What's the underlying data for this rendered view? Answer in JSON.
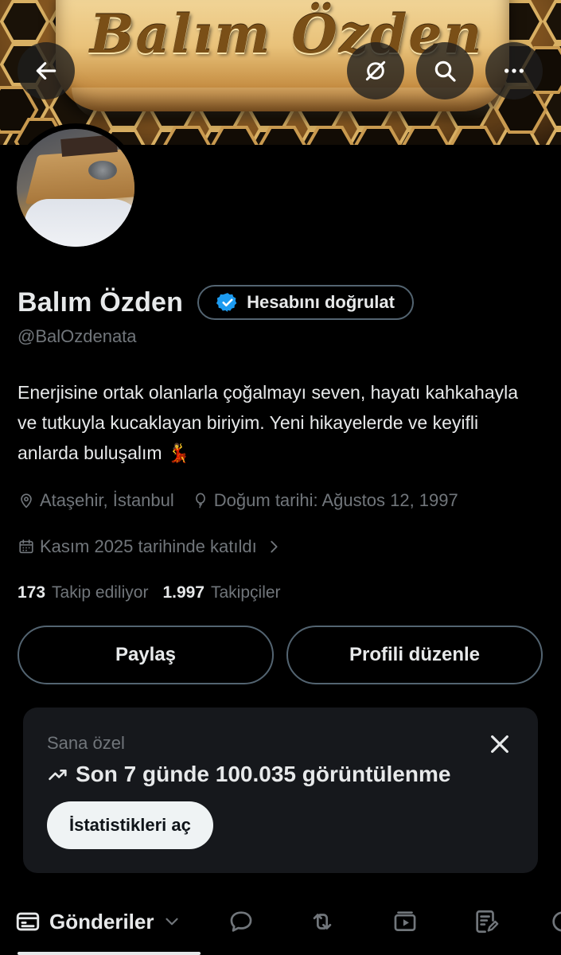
{
  "banner": {
    "title": "Balım Özden"
  },
  "profile": {
    "name": "Balım Özden",
    "verify_label": "Hesabını doğrulat",
    "handle": "@BalOzdenata",
    "bio": "Enerjisine ortak olanlarla çoğalmayı seven, hayatı kahkahayla ve tutkuyla kucaklayan biriyim. Yeni hikayelerde ve keyifli anlarda buluşalım 💃",
    "location": "Ataşehir, İstanbul",
    "birthday": "Doğum tarihi: Ağustos 12, 1997",
    "joined": "Kasım 2025 tarihinde katıldı",
    "following_count": "173",
    "following_label": "Takip ediliyor",
    "followers_count": "1.997",
    "followers_label": "Takipçiler"
  },
  "actions": {
    "share": "Paylaş",
    "edit_profile": "Profili düzenle"
  },
  "promo": {
    "label": "Sana özel",
    "stat": "Son 7 günde 100.035 görüntülenme",
    "button": "İstatistikleri aç"
  },
  "tabs": {
    "active": "Gönderiler"
  },
  "colors": {
    "background": "#000000",
    "text": "#e7e9ea",
    "muted": "#71767b",
    "border": "#536471",
    "verified_blue": "#1d9bf0",
    "card": "#16181c"
  }
}
